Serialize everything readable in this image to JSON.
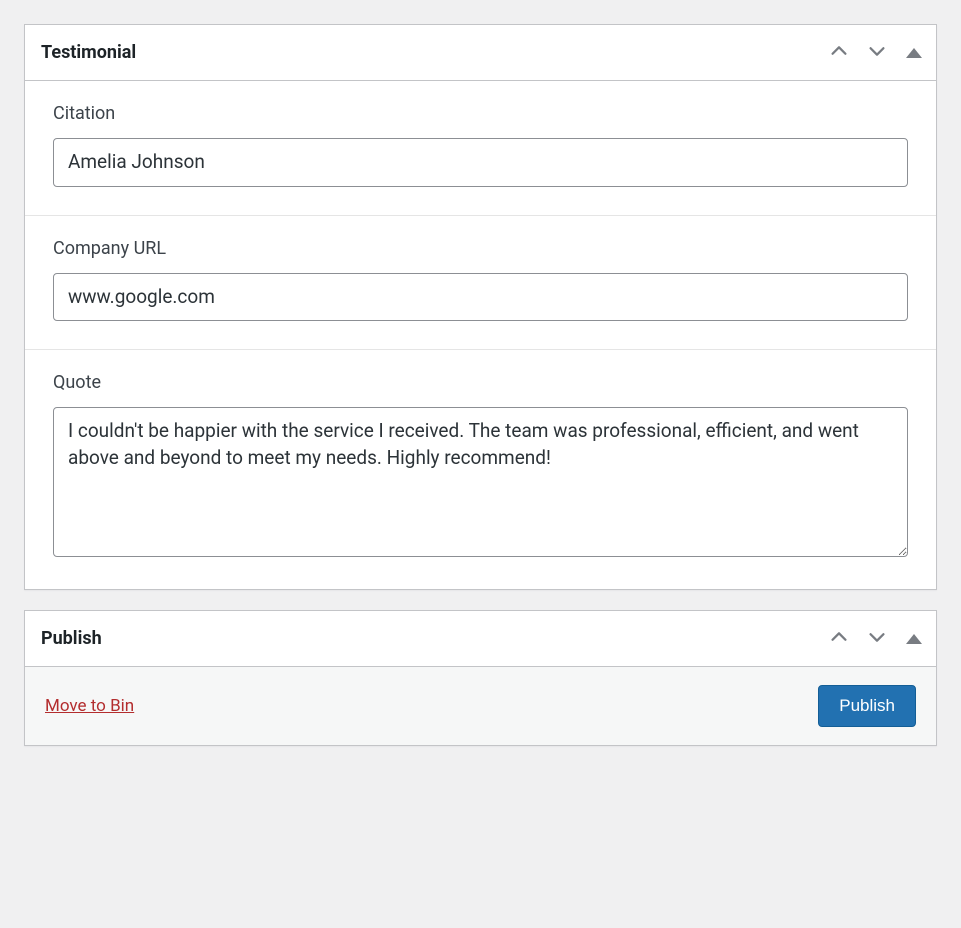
{
  "testimonial_box": {
    "title": "Testimonial",
    "fields": {
      "citation": {
        "label": "Citation",
        "value": "Amelia Johnson"
      },
      "company_url": {
        "label": "Company URL",
        "value": "www.google.com"
      },
      "quote": {
        "label": "Quote",
        "value": "I couldn't be happier with the service I received. The team was professional, efficient, and went above and beyond to meet my needs. Highly recommend!"
      }
    }
  },
  "publish_box": {
    "title": "Publish",
    "move_to_bin": "Move to Bin",
    "publish_button": "Publish"
  }
}
